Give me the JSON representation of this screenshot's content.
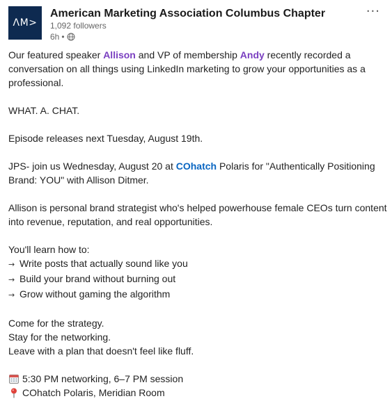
{
  "header": {
    "logo_text": "ΛM>",
    "org_name": "American Marketing Association Columbus Chapter",
    "followers": "1,092 followers",
    "time": "6h",
    "separator": "•",
    "more_icon": "more-horizontal-icon",
    "more_glyph": "···"
  },
  "post": {
    "p1_a": "Our featured speaker ",
    "mention1": "Allison",
    "p1_b": " and VP of membership ",
    "mention2": "Andy",
    "p1_c": " recently recorded a conversation on all things using LinkedIn marketing to grow your opportunities as a professional.",
    "p2": "WHAT. A. CHAT.",
    "p3": "Episode releases next Tuesday, August 19th.",
    "p4_a": "JPS- join us Wednesday, August 20 at ",
    "company": "COhatch",
    "p4_b": " Polaris for \"Authentically Positioning Brand: YOU\" with Allison Ditmer.",
    "p5": "Allison is personal brand strategist who's helped powerhouse female CEOs turn content into revenue, reputation, and real opportunities.",
    "learn_intro": "You'll learn how to:",
    "arrow_glyph": "→",
    "learn_items": [
      "Write posts that actually sound like you",
      "Build your brand without burning out",
      "Grow without gaming the algorithm"
    ],
    "closing": [
      "Come for the strategy.",
      "Stay for the networking.",
      "Leave with a plan that doesn't feel like fluff."
    ],
    "schedule": "5:30 PM networking, 6–7 PM session",
    "location": "COhatch Polaris, Meridian Room"
  },
  "colors": {
    "mention": "#7a3fc0",
    "company_link": "#0a66c2",
    "logo_bg": "#0e2a50"
  }
}
